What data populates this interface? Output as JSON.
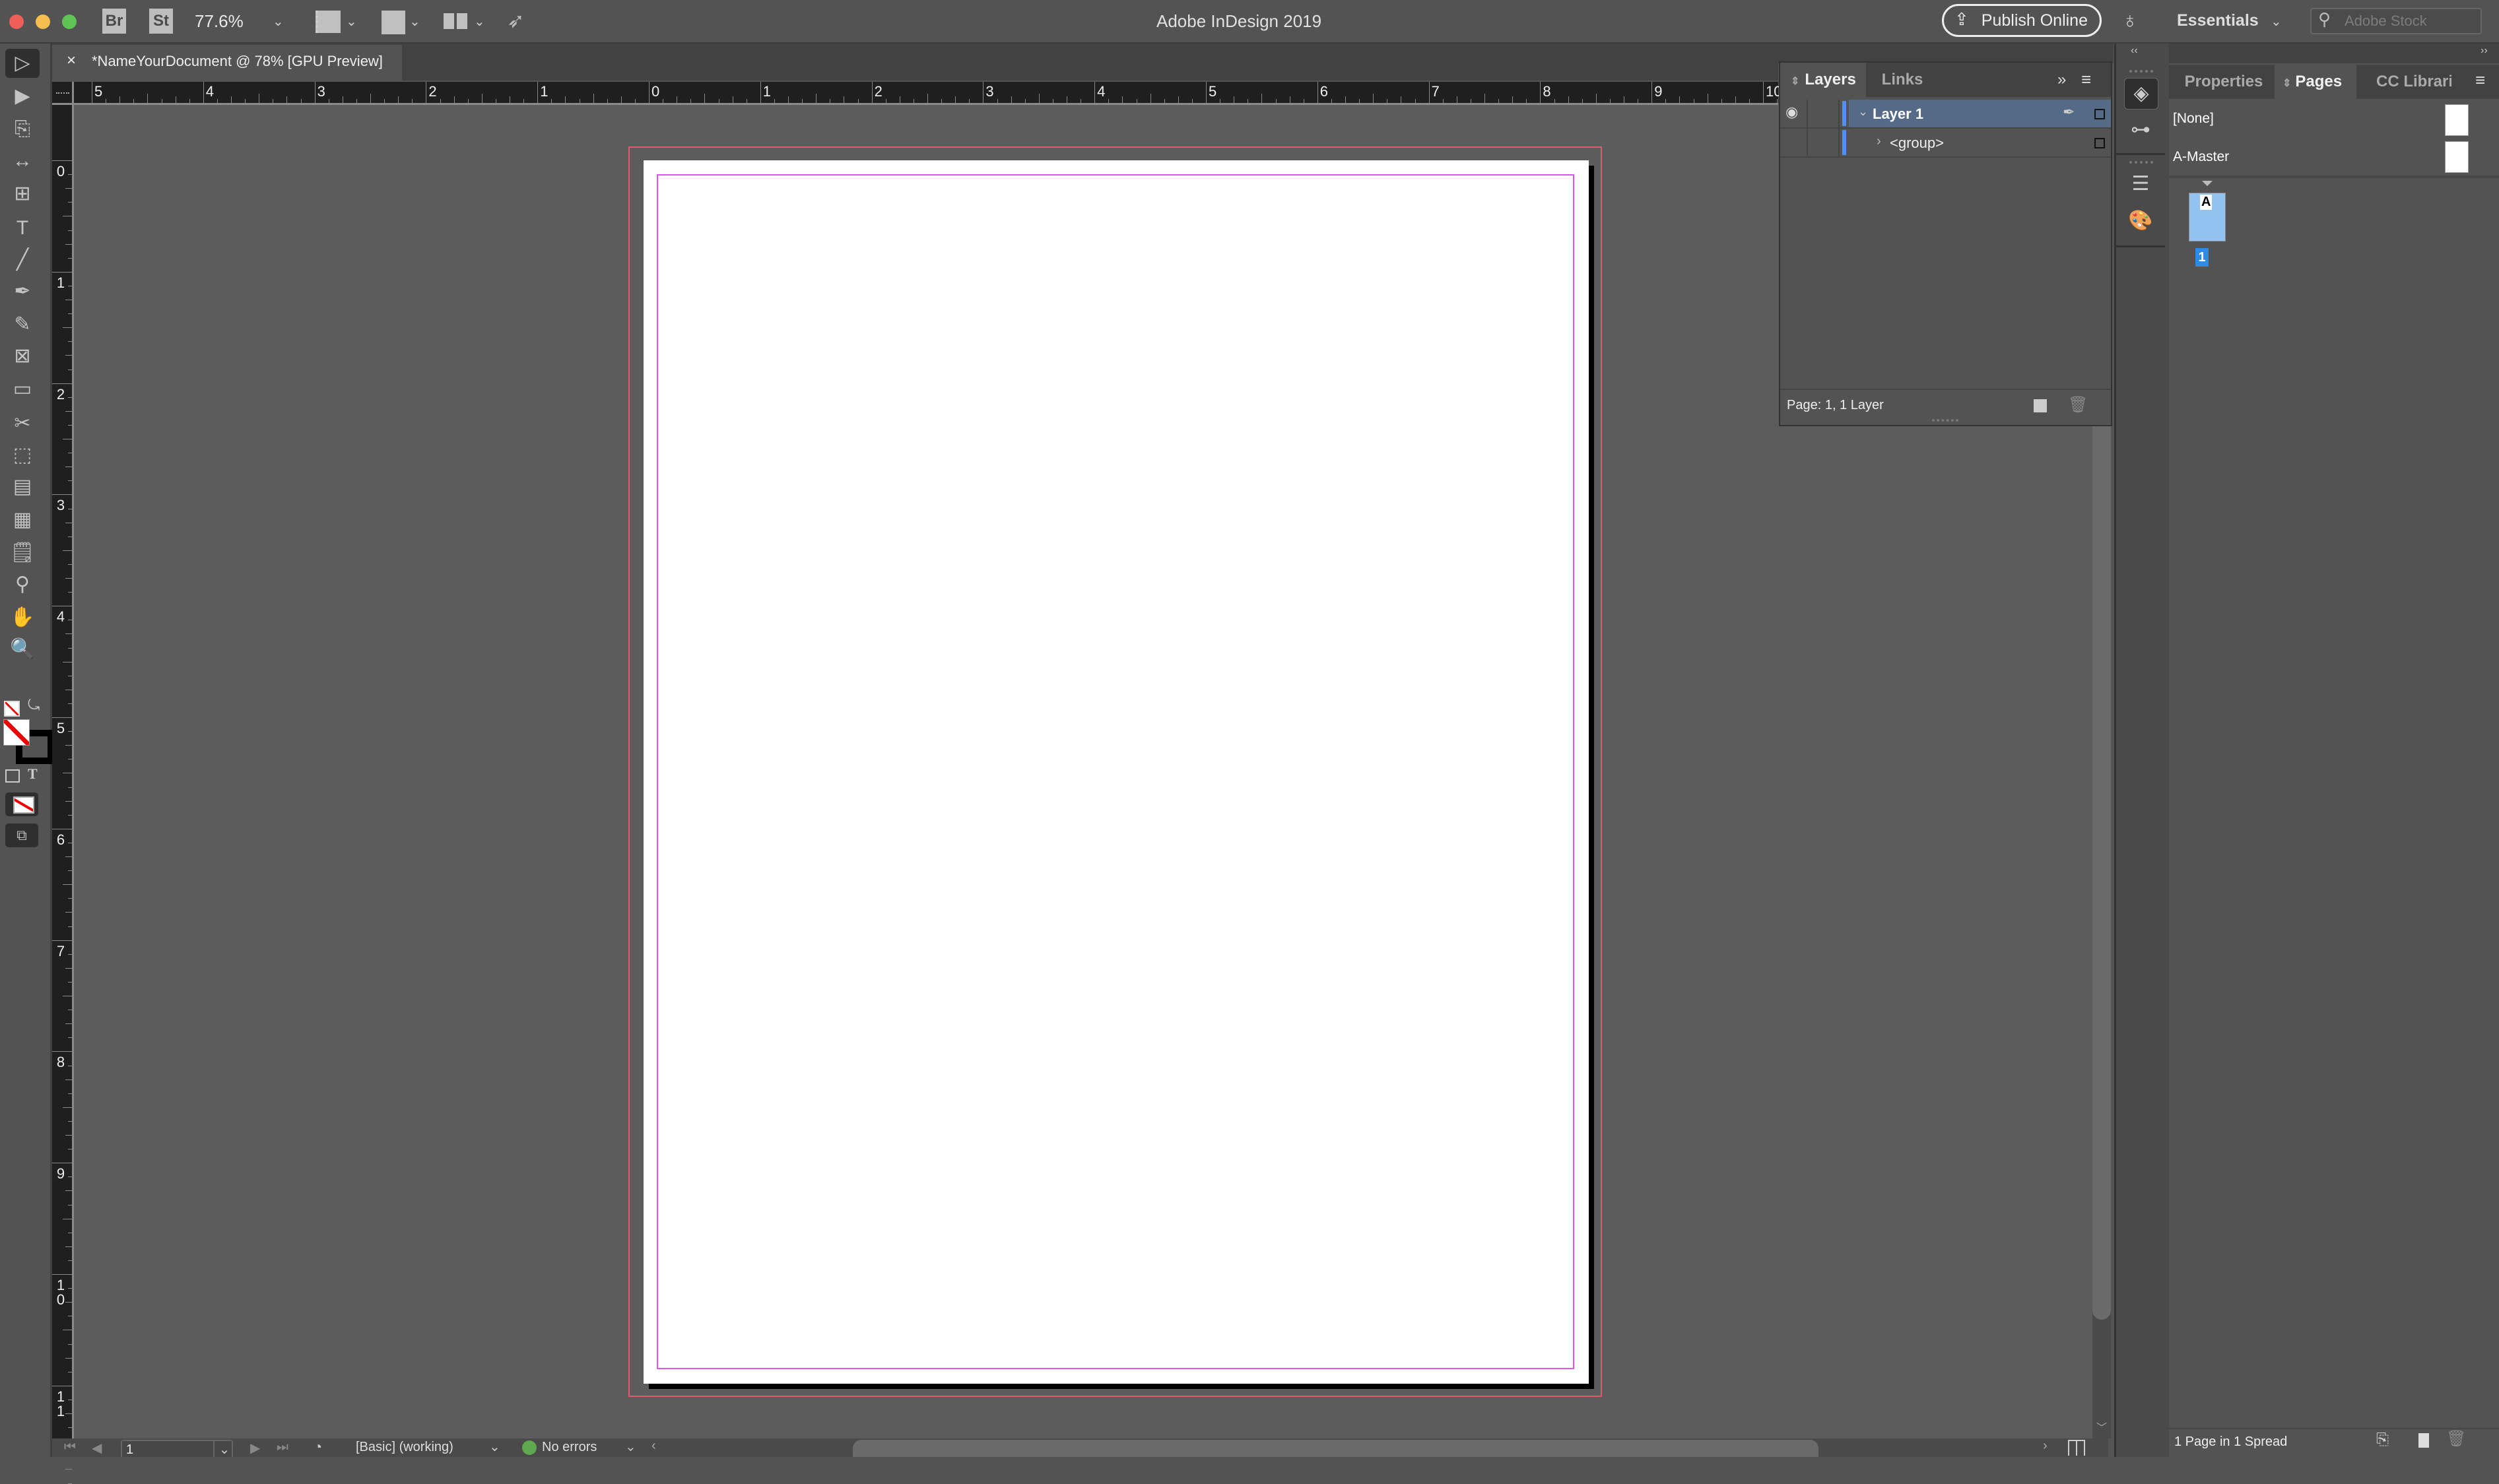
{
  "app": {
    "title": "Adobe InDesign 2019",
    "bridge_label": "Br",
    "stock_label": "St",
    "zoom_level": "77.6%",
    "publish_label": "Publish Online",
    "workspace": "Essentials",
    "search_placeholder": "Adobe Stock"
  },
  "document": {
    "tab_title": "*NameYourDocument @ 78% [GPU Preview]",
    "close_glyph": "×"
  },
  "rulers": {
    "horizontal": [
      "5",
      "4",
      "3",
      "2",
      "1",
      "0",
      "1",
      "2",
      "3",
      "4",
      "5",
      "6",
      "7",
      "8",
      "9",
      "10"
    ],
    "vertical": [
      "0",
      "1",
      "2",
      "3",
      "4",
      "5",
      "6",
      "7",
      "8",
      "9",
      "10",
      "11"
    ]
  },
  "tools": [
    {
      "name": "selection-tool",
      "glyph": "▷"
    },
    {
      "name": "direct-selection-tool",
      "glyph": "▶"
    },
    {
      "name": "page-tool",
      "glyph": "⎘"
    },
    {
      "name": "gap-tool",
      "glyph": "↔"
    },
    {
      "name": "content-collector-tool",
      "glyph": "⊞"
    },
    {
      "name": "type-tool",
      "glyph": "T"
    },
    {
      "name": "line-tool",
      "glyph": "╱"
    },
    {
      "name": "pen-tool",
      "glyph": "✒"
    },
    {
      "name": "pencil-tool",
      "glyph": "✎"
    },
    {
      "name": "rectangle-frame-tool",
      "glyph": "⊠"
    },
    {
      "name": "rectangle-tool",
      "glyph": "▭"
    },
    {
      "name": "scissors-tool",
      "glyph": "✂"
    },
    {
      "name": "free-transform-tool",
      "glyph": "⬚"
    },
    {
      "name": "gradient-swatch-tool",
      "glyph": "▤"
    },
    {
      "name": "gradient-feather-tool",
      "glyph": "▦"
    },
    {
      "name": "note-tool",
      "glyph": "🗒"
    },
    {
      "name": "eyedropper-tool",
      "glyph": "⚲"
    },
    {
      "name": "hand-tool",
      "glyph": "✋"
    },
    {
      "name": "zoom-tool",
      "glyph": "🔍"
    }
  ],
  "layers_panel": {
    "tabs": [
      "Layers",
      "Links"
    ],
    "active_tab": "Layers",
    "rows": [
      {
        "label": "Layer 1",
        "expanded": true,
        "selected": true
      },
      {
        "label": "<group>",
        "expanded": false,
        "selected": false
      }
    ],
    "footer": "Page: 1, 1 Layer"
  },
  "right_panel": {
    "tabs": [
      "Properties",
      "Pages",
      "CC Libraries"
    ],
    "active_tab": "Pages",
    "masters": [
      "[None]",
      "A-Master"
    ],
    "page_thumb_master": "A",
    "page_number": "1",
    "footer": "1 Page in 1 Spread"
  },
  "status_bar": {
    "page_field": "1",
    "preflight_profile": "[Basic] (working)",
    "preflight_status": "No errors",
    "status_color": "#5fa84f"
  },
  "colors": {
    "selected_layer": "#546a87",
    "layer_color": "#4f8ff0",
    "page_selected": "#93c1f0",
    "page_number_badge": "#2d8ae6"
  }
}
